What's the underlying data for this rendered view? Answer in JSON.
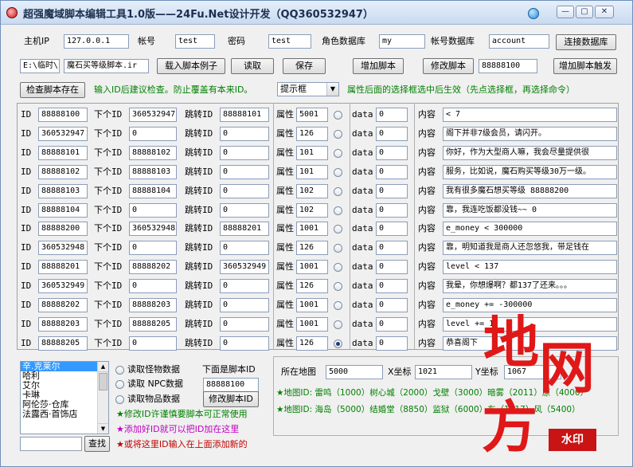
{
  "window": {
    "title": "超强魔域脚本编辑工具1.0版——24Fu.Net设计开发（QQ360532947）",
    "min": "—",
    "max": "▢",
    "close": "✕"
  },
  "connection": {
    "host_label": "主机IP",
    "host_value": "127.0.0.1",
    "user_label": "帐号",
    "user_value": "test",
    "pass_label": "密码",
    "pass_value": "test",
    "roledb_label": "角色数据库",
    "roledb_value": "my",
    "acctdb_label": "帐号数据库",
    "acctdb_value": "account",
    "connect_button": "连接数据库"
  },
  "file": {
    "path_value": "E:\\临时\\",
    "script_name": "魔石买等级脚本.ir",
    "load_example_button": "载入脚本例子",
    "read_button": "读取",
    "save_button": "保存",
    "add_script_button": "增加脚本",
    "modify_script_button": "修改脚本",
    "trigger_id": "88888100",
    "add_trigger_button": "增加脚本触发"
  },
  "check": {
    "check_button": "检查脚本存在",
    "hint": "输入ID后建议检查。防止覆盖有本来ID。",
    "dropdown_value": "提示框",
    "attr_hint": "属性后面的选择框选中后生效（先点选择框，再选择命令）"
  },
  "row_labels": {
    "id": "ID",
    "next_id": "下个ID",
    "jump_id": "跳转ID",
    "attr": "属性",
    "data": "data",
    "content": "内容"
  },
  "rows": [
    {
      "id": "88888100",
      "next": "360532947",
      "jump": "88888101",
      "attr": "5001",
      "data": "0",
      "content": "< 7",
      "checked": false
    },
    {
      "id": "360532947",
      "next": "0",
      "jump": "0",
      "attr": "126",
      "data": "0",
      "content": "阁下并非7级会员，请闪开。",
      "checked": false
    },
    {
      "id": "88888101",
      "next": "88888102",
      "jump": "0",
      "attr": "101",
      "data": "0",
      "content": "你好，作为大型商人嘛，我会尽量提供很",
      "checked": false
    },
    {
      "id": "88888102",
      "next": "88888103",
      "jump": "0",
      "attr": "101",
      "data": "0",
      "content": "服务，比如说，魔石购买等级30万一级。",
      "checked": false
    },
    {
      "id": "88888103",
      "next": "88888104",
      "jump": "0",
      "attr": "102",
      "data": "0",
      "content": "我有很多魔石想买等级 88888200",
      "checked": false
    },
    {
      "id": "88888104",
      "next": "0",
      "jump": "0",
      "attr": "102",
      "data": "0",
      "content": "靠，我连吃饭都没钱~~ 0",
      "checked": false
    },
    {
      "id": "88888200",
      "next": "360532948",
      "jump": "88888201",
      "attr": "1001",
      "data": "0",
      "content": "e_money < 300000",
      "checked": false
    },
    {
      "id": "360532948",
      "next": "0",
      "jump": "0",
      "attr": "126",
      "data": "0",
      "content": "靠，明知道我是商人还忽悠我，带足钱在",
      "checked": false
    },
    {
      "id": "88888201",
      "next": "88888202",
      "jump": "360532949",
      "attr": "1001",
      "data": "0",
      "content": "level < 137",
      "checked": false
    },
    {
      "id": "360532949",
      "next": "0",
      "jump": "0",
      "attr": "126",
      "data": "0",
      "content": "我晕，你想爆啊？都137了还来。。。",
      "checked": false
    },
    {
      "id": "88888202",
      "next": "88888203",
      "jump": "0",
      "attr": "1001",
      "data": "0",
      "content": "e_money += -300000",
      "checked": false
    },
    {
      "id": "88888203",
      "next": "88888205",
      "jump": "0",
      "attr": "1001",
      "data": "0",
      "content": "level += 1",
      "checked": false
    },
    {
      "id": "88888205",
      "next": "0",
      "jump": "0",
      "attr": "126",
      "data": "0",
      "content": "恭喜阁下",
      "checked": true
    }
  ],
  "bottom": {
    "list_items": [
      "辛.克莱尔",
      "哈利",
      "艾尔",
      "卡琳",
      "阿伦莎·仓库",
      "法露西·首饰店"
    ],
    "find_button": "查找",
    "radio_monster": "读取怪物数据",
    "radio_npc": "读取 NPC数据",
    "radio_item": "读取物品数据",
    "script_id_label": "下面是脚本ID",
    "script_id_value": "88888100",
    "modify_id_button": "修改脚本ID",
    "note1": "★修改ID许谨慎要脚本可正常使用",
    "note2": "★添加好ID就可以把ID加在这里",
    "note3": "★或将这里ID输入在上面添加新的",
    "map_label": "所在地图",
    "map_value": "5000",
    "x_label": "X坐标",
    "x_value": "1021",
    "y_label": "Y坐标",
    "y_value": "1067",
    "map_list1": "★地图ID: 雷鸣（1000）树心城（2000）戈壁（3000）暗雾（2011）原（4000）",
    "map_list2": "★地图ID: 海岛（5000）结婚堂（8850）监狱（6000）东（1917）风（5400）"
  },
  "watermark": {
    "char1": "地",
    "char2": "网",
    "char3": "方",
    "stamp": "水印"
  },
  "colors": {
    "green_text": "#008000",
    "watermark_red": "#e01818",
    "selection_blue": "#3399ff"
  }
}
